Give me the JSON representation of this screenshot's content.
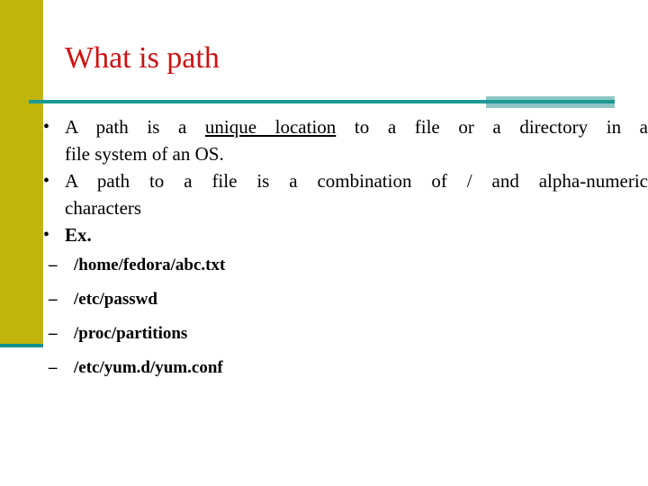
{
  "slide": {
    "title": "What is path",
    "theme": {
      "accent_olive": "#c2b50a",
      "accent_teal": "#1b9a96",
      "accent_teal_light": "#8ec6c4",
      "title_red": "#cc1111",
      "background": "#ffffff",
      "body_text": "#000000"
    },
    "bullets": [
      {
        "marker": "•",
        "line1_prefix": "A path is a ",
        "line1_underlined": "unique location",
        "line1_suffix": " to a file or a directory in a",
        "line2": "file system of an OS.",
        "bold": false
      },
      {
        "marker": "•",
        "line1_prefix": "A path to a file is a combination of / and alpha-numeric",
        "line1_underlined": "",
        "line1_suffix": "",
        "line2": "characters",
        "bold": false
      },
      {
        "marker": "•",
        "line1_prefix": "Ex.",
        "line1_underlined": "",
        "line1_suffix": "",
        "line2": "",
        "bold": true
      }
    ],
    "sub_bullets": [
      {
        "marker": "–",
        "text": "/home/fedora/abc.txt"
      },
      {
        "marker": "–",
        "text": "/etc/passwd"
      },
      {
        "marker": "–",
        "text": "/proc/partitions"
      },
      {
        "marker": "–",
        "text": "/etc/yum.d/yum.conf"
      }
    ]
  }
}
